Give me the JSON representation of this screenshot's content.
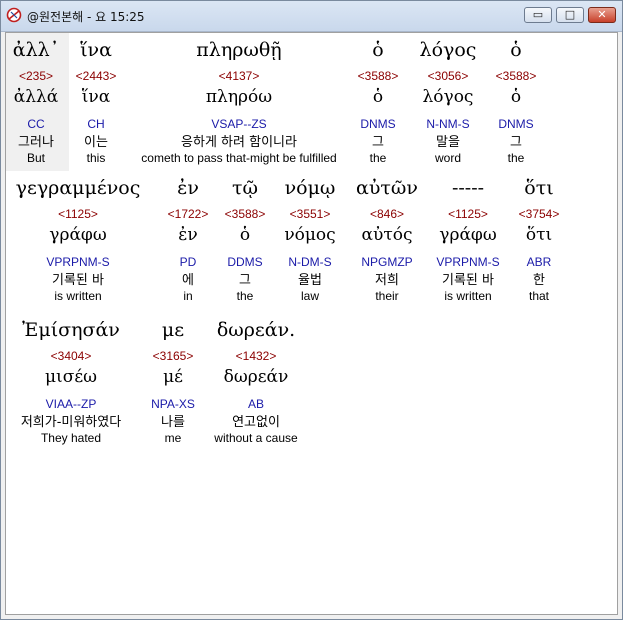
{
  "window": {
    "title": "@원전본해 - 요 15:25",
    "buttons": {
      "minimize": "▭",
      "maximize": "□",
      "close": "✕"
    }
  },
  "colors": {
    "strong_number": "#8b0000",
    "morphology": "#1a1aa8",
    "selected_background": "#f0f0f0"
  },
  "rows": [
    {
      "words": [
        {
          "greek": "ἀλλ᾽",
          "strong": "<235>",
          "lemma": "ἀλλά",
          "morph": "CC",
          "korean": "그러나",
          "english": "But"
        },
        {
          "greek": "ἵνα",
          "strong": "<2443>",
          "lemma": "ἵνα",
          "morph": "CH",
          "korean": "이는",
          "english": "this"
        },
        {
          "greek": "πληρωθῇ",
          "strong": "<4137>",
          "lemma": "πληρόω",
          "morph": "VSAP--ZS",
          "korean": "응하게 하려 함이니라",
          "english": "cometh to pass that-might be fulfilled"
        },
        {
          "greek": "ὁ",
          "strong": "<3588>",
          "lemma": "ὁ",
          "morph": "DNMS",
          "korean": "그",
          "english": "the"
        },
        {
          "greek": "λόγος",
          "strong": "<3056>",
          "lemma": "λόγος",
          "morph": "N-NM-S",
          "korean": "말을",
          "english": "word"
        },
        {
          "greek": "ὁ",
          "strong": "<3588>",
          "lemma": "ὁ",
          "morph": "DNMS",
          "korean": "그",
          "english": "the"
        }
      ]
    },
    {
      "words": [
        {
          "greek": "γεγραμμένος",
          "strong": "<1125>",
          "lemma": "γράφω",
          "morph": "VPRPNM-S",
          "korean": "기록된 바",
          "english": "is written"
        },
        {
          "greek": "ἐν",
          "strong": "<1722>",
          "lemma": "ἐν",
          "morph": "PD",
          "korean": "에",
          "english": "in"
        },
        {
          "greek": "τῷ",
          "strong": "<3588>",
          "lemma": "ὁ",
          "morph": "DDMS",
          "korean": "그",
          "english": "the"
        },
        {
          "greek": "νόμῳ",
          "strong": "<3551>",
          "lemma": "νόμος",
          "morph": "N-DM-S",
          "korean": "율법",
          "english": "law"
        },
        {
          "greek": "αὐτῶν",
          "strong": "<846>",
          "lemma": "αὐτός",
          "morph": "NPGMZP",
          "korean": "저희",
          "english": "their"
        },
        {
          "greek": "-----",
          "strong": "<1125>",
          "lemma": "γράφω",
          "morph": "VPRPNM-S",
          "korean": "기록된 바",
          "english": "is written"
        },
        {
          "greek": "ὅτι",
          "strong": "<3754>",
          "lemma": "ὅτι",
          "morph": "ABR",
          "korean": "한",
          "english": "that"
        }
      ]
    },
    {
      "words": [
        {
          "greek": "Ἐμίσησάν",
          "strong": "<3404>",
          "lemma": "μισέω",
          "morph": "VIAA--ZP",
          "korean": "저희가-미워하였다",
          "english": "They hated"
        },
        {
          "greek": "με",
          "strong": "<3165>",
          "lemma": "μέ",
          "morph": "NPA-XS",
          "korean": "나를",
          "english": "me"
        },
        {
          "greek": "δωρεάν.",
          "strong": "<1432>",
          "lemma": "δωρεάν",
          "morph": "AB",
          "korean": "연고없이",
          "english": "without a cause"
        }
      ]
    }
  ]
}
